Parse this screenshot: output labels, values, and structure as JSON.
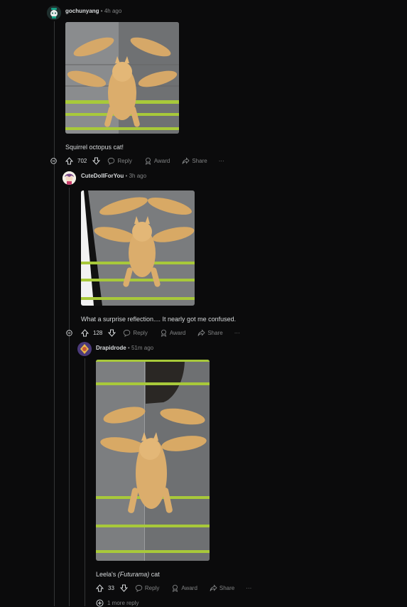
{
  "icons": {
    "collapse": "minus-circle-icon",
    "upvote": "arrow-up-icon",
    "downvote": "arrow-down-icon",
    "reply": "speech-bubble-icon",
    "award": "award-ribbon-icon",
    "share": "share-arrow-icon",
    "more": "ellipsis-icon",
    "expand": "plus-circle-icon"
  },
  "colors": {
    "background": "#0b0b0c",
    "thread_line": "#343536",
    "text_primary": "#d7dadc",
    "text_muted": "#818384"
  },
  "comments": [
    {
      "username": "gochunyang",
      "time": "4h ago",
      "separator": "•",
      "body": "Squirrel octopus cat!",
      "score": "702",
      "reply_label": "Reply",
      "award_label": "Award",
      "share_label": "Share",
      "more_label": "···"
    },
    {
      "username": "CuteDollForYou",
      "time": "3h ago",
      "separator": "•",
      "body": "What a surprise reflection.... It nearly got me confused.",
      "score": "128",
      "reply_label": "Reply",
      "award_label": "Award",
      "share_label": "Share",
      "more_label": "···"
    },
    {
      "username": "Drapidrode",
      "time": "51m ago",
      "separator": "•",
      "body_prefix": "Leela's ",
      "body_italic": "(Futurama)",
      "body_suffix": " cat",
      "score": "33",
      "reply_label": "Reply",
      "award_label": "Award",
      "share_label": "Share",
      "more_label": "···"
    }
  ],
  "more_replies_label": "1 more reply"
}
